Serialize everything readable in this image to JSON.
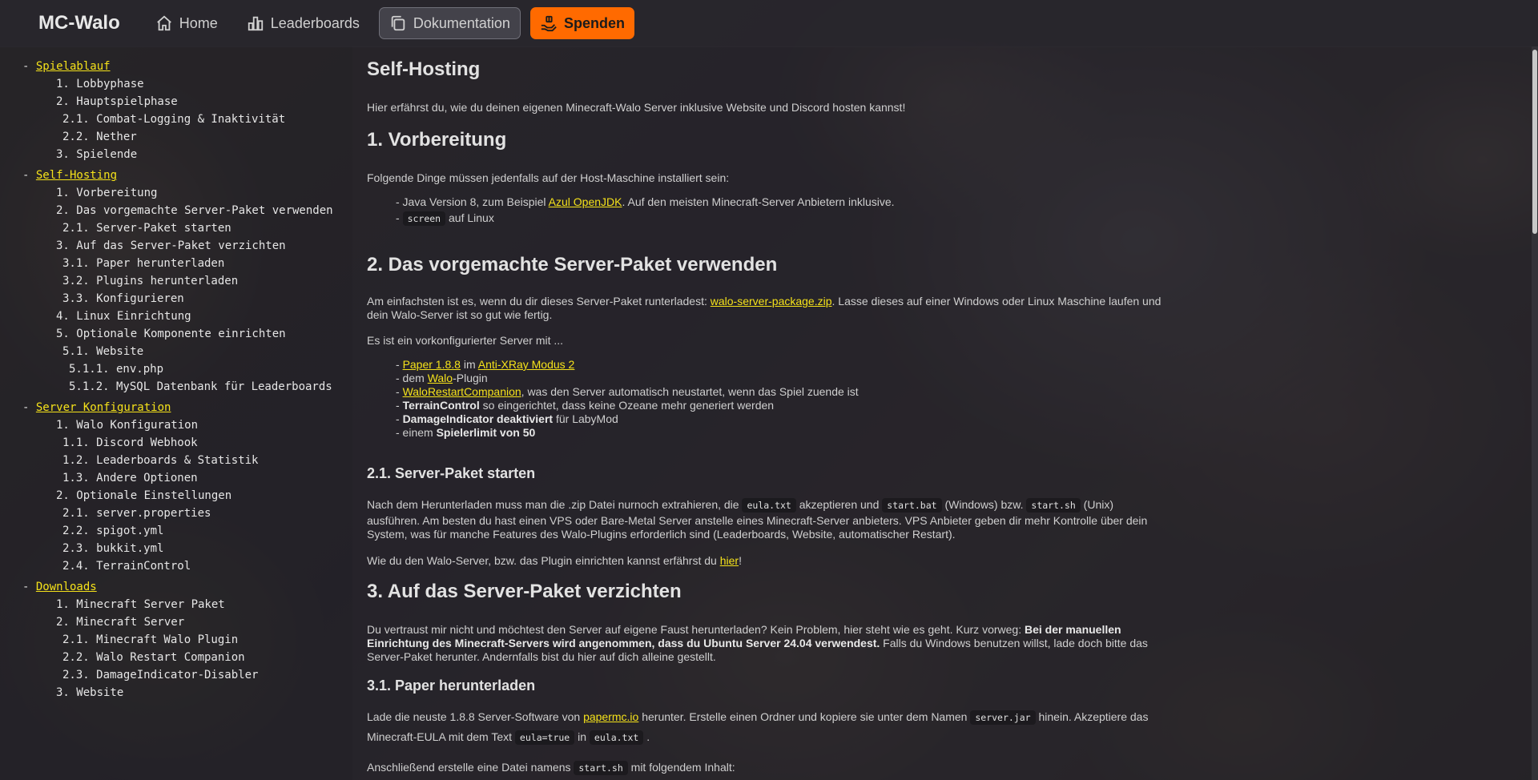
{
  "nav": {
    "brand": "MC-Walo",
    "items": [
      {
        "label": "Home",
        "icon": "home-icon"
      },
      {
        "label": "Leaderboards",
        "icon": "bar-chart-icon"
      },
      {
        "label": "Dokumentation",
        "icon": "documents-icon"
      },
      {
        "label": "Spenden",
        "icon": "donate-hand-icon"
      }
    ],
    "colors": {
      "donate_bg": "#ff6a00",
      "link": "#f5e21a"
    }
  },
  "sidebar": {
    "sections": [
      {
        "title": "Spielablauf",
        "items": [
          "1. Lobbyphase",
          "2. Hauptspielphase",
          "2.1. Combat-Logging & Inaktivität",
          "2.2. Nether",
          "3. Spielende"
        ]
      },
      {
        "title": "Self-Hosting",
        "items": [
          "1. Vorbereitung",
          "2. Das vorgemachte Server-Paket verwenden",
          "2.1. Server-Paket starten",
          "3. Auf das Server-Paket verzichten",
          "3.1. Paper herunterladen",
          "3.2. Plugins herunterladen",
          "3.3. Konfigurieren",
          "4. Linux Einrichtung",
          "5. Optionale Komponente einrichten",
          "5.1. Website",
          "5.1.1. env.php",
          "5.1.2. MySQL Datenbank für Leaderboards"
        ]
      },
      {
        "title": "Server Konfiguration",
        "items": [
          "1. Walo Konfiguration",
          "1.1. Discord Webhook",
          "1.2. Leaderboards & Statistik",
          "1.3. Andere Optionen",
          "2. Optionale Einstellungen",
          "2.1. server.properties",
          "2.2. spigot.yml",
          "2.3. bukkit.yml",
          "2.4. TerrainControl"
        ]
      },
      {
        "title": "Downloads",
        "items": [
          "1. Minecraft Server Paket",
          "2. Minecraft Server",
          "2.1. Minecraft Walo Plugin",
          "2.2. Walo Restart Companion",
          "2.3. DamageIndicator-Disabler",
          "3. Website"
        ]
      }
    ]
  },
  "content": {
    "title": "Self-Hosting",
    "intro": "Hier erfährst du, wie du deinen eigenen Minecraft-Walo Server inklusive Website und Discord hosten kannst!",
    "h_vorbereitung": "1.  Vorbereitung",
    "vorb_text": "Folgende Dinge müssen jedenfalls auf der Host-Maschine installiert sein:",
    "vorb_java_pre": "- Java Version 8, zum Beispiel ",
    "vorb_java_link": "Azul OpenJDK",
    "vorb_java_post": ". Auf den meisten Minecraft-Server Anbietern inklusive.",
    "vorb_screen_pre": "- ",
    "vorb_screen_code": "screen",
    "vorb_screen_post": " auf Linux",
    "h_paket": "2.  Das vorgemachte Server-Paket verwenden",
    "paket_l1_pre": "Am einfachsten ist es, wenn du dir dieses Server-Paket runterladest: ",
    "paket_l1_link": "walo-server-package.zip",
    "paket_l1_post": ". Lasse dieses auf einer Windows oder Linux Maschine laufen und",
    "paket_l2": "dein Walo-Server ist so gut wie fertig.",
    "paket_vork": "Es ist ein vorkonfigurierter Server mit ...",
    "list_paper_pre": "- ",
    "list_paper_link": "Paper 1.8.8",
    "list_paper_mid": " im ",
    "list_paper_link2": "Anti-XRay Modus 2",
    "list_walo_pre": "- dem ",
    "list_walo_link": "Walo",
    "list_walo_post": "-Plugin",
    "list_restart_pre": "- ",
    "list_restart_link": "WaloRestartCompanion",
    "list_restart_post": ", was den Server automatisch neustartet, wenn das Spiel zuende ist",
    "list_terrain_pre": "- ",
    "list_terrain_bold": "TerrainControl",
    "list_terrain_post": " so eingerichtet, dass keine Ozeane mehr generiert werden",
    "list_damage_pre": "- ",
    "list_damage_bold": "DamageIndicator deaktiviert",
    "list_damage_post": " für LabyMod",
    "list_limit_pre": "- einem ",
    "list_limit_bold": "Spielerlimit von 50",
    "h_starten": "2.1.  Server-Paket starten",
    "start_l1_a": "Nach dem Herunterladen muss man die .zip Datei nurnoch extrahieren, die ",
    "start_l1_code1": "eula.txt",
    "start_l1_b": " akzeptieren und ",
    "start_l1_code2": "start.bat",
    "start_l1_c": " (Windows) bzw. ",
    "start_l1_code3": "start.sh",
    "start_l1_d": " (Unix)",
    "start_l2": "ausführen. Am besten du hast einen VPS oder Bare-Metal Server anstelle eines Minecraft-Server anbieters. VPS Anbieter geben dir mehr Kontrolle über dein",
    "start_l3": "System, was für manche Features des Walo-Plugins erforderlich sind (Leaderboards, Website, automatischer Restart).",
    "start_hier_pre": "Wie du den Walo-Server, bzw. das Plugin einrichten kannst erfährst du ",
    "start_hier_link": "hier",
    "start_hier_post": "!",
    "h_verzichten": "3.  Auf das Server-Paket verzichten",
    "verz_l1_pre": "Du vertraust mir nicht und möchtest den Server auf eigene Faust herunterladen? Kein Problem, hier steht wie es geht. Kurz vorweg: ",
    "verz_l1_bold": "Bei der manuellen",
    "verz_l2_bold": "Einrichtung des Minecraft-Servers wird angenommen, dass du Ubuntu Server 24.04 verwendest.",
    "verz_l2_post": " Falls du Windows benutzen willst, lade doch bitte das",
    "verz_l3": "Server-Paket herunter. Andernfalls bist du hier auf dich alleine gestellt.",
    "h_paper": "3.1.  Paper herunterladen",
    "paper_l1_a": "Lade die neuste 1.8.8 Server-Software von ",
    "paper_l1_link": "papermc.io",
    "paper_l1_b": " herunter. Erstelle einen Ordner und kopiere sie unter dem Namen ",
    "paper_l1_code": "server.jar",
    "paper_l1_c": " hinein. Akzeptiere das",
    "paper_l2_a": "Minecraft-EULA mit dem Text ",
    "paper_l2_code1": "eula=true",
    "paper_l2_b": " in ",
    "paper_l2_code2": "eula.txt",
    "paper_l2_c": " .",
    "paper_l3_a": "Anschließend erstelle eine Datei namens ",
    "paper_l3_code": "start.sh",
    "paper_l3_b": " mit folgendem Inhalt:"
  }
}
